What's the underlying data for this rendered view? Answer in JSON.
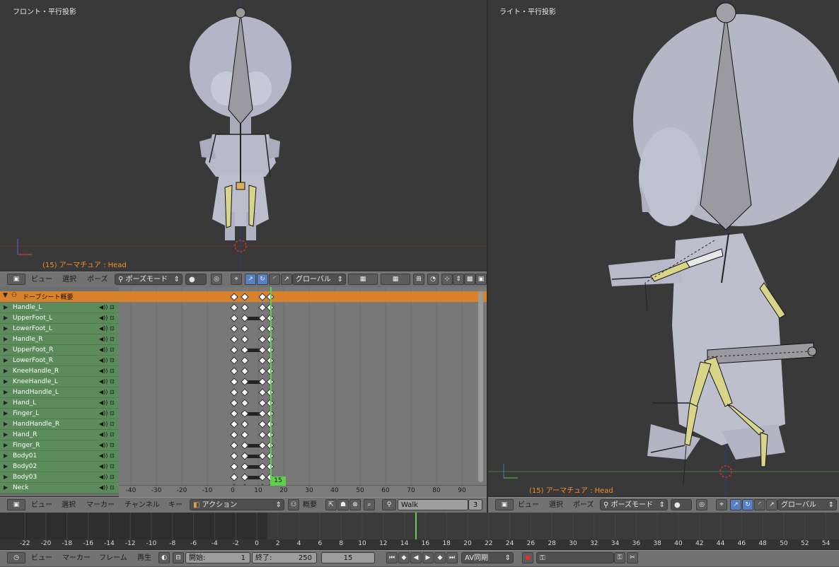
{
  "viewport_front": {
    "label": "フロント・平行投影",
    "info": "(15) アーマチュア : Head"
  },
  "viewport_right": {
    "label": "ライト・平行投影",
    "info": "(15) アーマチュア : Head"
  },
  "view3d_header_left": {
    "view": "ビュー",
    "select": "選択",
    "pose": "ポーズ",
    "mode": "ポーズモード",
    "orientation": "グローバル"
  },
  "view3d_header_right": {
    "view": "ビュー",
    "select": "選択",
    "pose": "ポーズ",
    "mode": "ポーズモード",
    "orientation": "グローバル"
  },
  "dopesheet": {
    "summary": "ドープシート概要",
    "channels": [
      "Handle_L",
      "UpperFoot_L",
      "LowerFoot_L",
      "Handle_R",
      "UpperFoot_R",
      "LowerFoot_R",
      "KneeHandle_R",
      "KneeHandle_L",
      "HandHandle_L",
      "Hand_L",
      "Finger_L",
      "HandHandle_R",
      "Hand_R",
      "Finger_R",
      "Body01",
      "Body02",
      "Body03",
      "Neck"
    ],
    "ruler": [
      "-40",
      "-30",
      "-20",
      "-10",
      "0",
      "10",
      "15",
      "20",
      "30",
      "40",
      "50",
      "60",
      "70",
      "80",
      "90"
    ],
    "current_frame": "15"
  },
  "dopesheet_header": {
    "view": "ビュー",
    "select": "選択",
    "marker": "マーカー",
    "channel": "チャンネル",
    "key": "キー",
    "mode": "アクション",
    "summary": "概要",
    "action_name": "Walk",
    "users": "3"
  },
  "timeline": {
    "ruler": [
      "-22",
      "-20",
      "-18",
      "-16",
      "-14",
      "-12",
      "-10",
      "-8",
      "-6",
      "-4",
      "-2",
      "0",
      "2",
      "4",
      "6",
      "8",
      "10",
      "12",
      "14",
      "16",
      "18",
      "20",
      "22",
      "24",
      "26",
      "28",
      "30",
      "32",
      "34",
      "36",
      "38",
      "40",
      "42",
      "44",
      "46",
      "48",
      "50",
      "52",
      "54"
    ]
  },
  "timeline_header": {
    "view": "ビュー",
    "marker": "マーカー",
    "frame": "フレーム",
    "playback": "再生",
    "start_label": "開始:",
    "start_value": "1",
    "end_label": "終了:",
    "end_value": "250",
    "current": "15",
    "sync": "AV同期"
  }
}
